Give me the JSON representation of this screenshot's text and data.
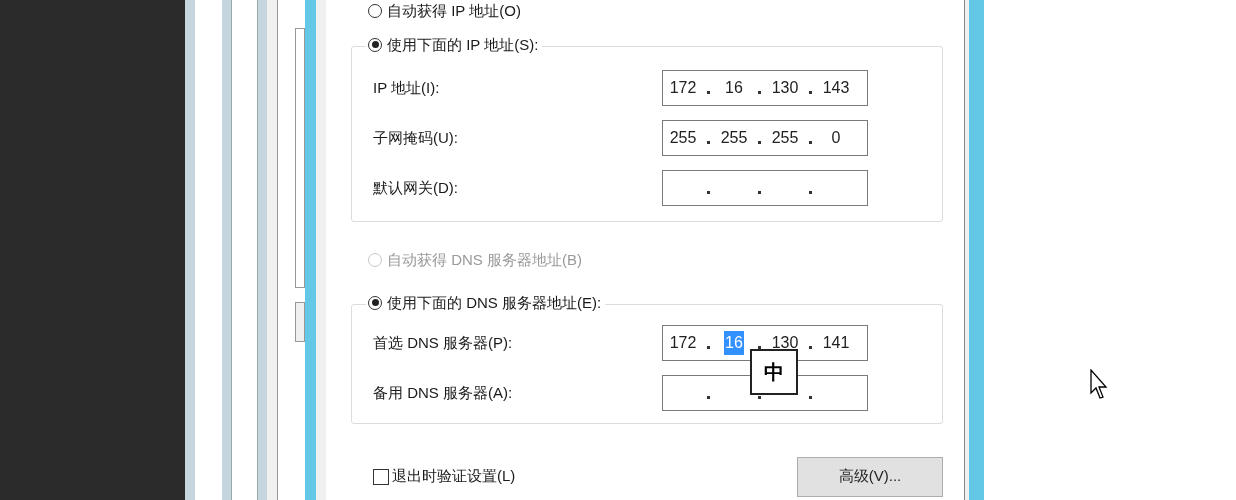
{
  "ip_mode": [
    {
      "label": "自动获得 IP 地址(O)",
      "selected": false,
      "disabled": false
    },
    {
      "label": "使用下面的 IP 地址(S):",
      "selected": true,
      "disabled": false
    }
  ],
  "ip_fields": [
    {
      "label": "IP 地址(I):",
      "octets": [
        {
          "text": "172",
          "selected": false
        },
        {
          "text": "16",
          "selected": false
        },
        {
          "text": "130",
          "selected": false
        },
        {
          "text": "143",
          "selected": false
        }
      ]
    },
    {
      "label": "子网掩码(U):",
      "octets": [
        {
          "text": "255",
          "selected": false
        },
        {
          "text": "255",
          "selected": false
        },
        {
          "text": "255",
          "selected": false
        },
        {
          "text": "0",
          "selected": false
        }
      ]
    },
    {
      "label": "默认网关(D):"
    }
  ],
  "dns_mode": [
    {
      "label": "自动获得 DNS 服务器地址(B)",
      "selected": false,
      "disabled": true
    },
    {
      "label": "使用下面的 DNS 服务器地址(E):",
      "selected": true,
      "disabled": false
    }
  ],
  "dns_fields": [
    {
      "label": "首选 DNS 服务器(P):",
      "octets": [
        {
          "text": "172",
          "selected": false
        },
        {
          "text": "16",
          "selected": true
        },
        {
          "text": "130",
          "selected": false
        },
        {
          "text": "141",
          "selected": false
        }
      ]
    },
    {
      "label": "备用 DNS 服务器(A):"
    }
  ],
  "ime_indicator": "中",
  "validate_on_exit": {
    "label": "退出时验证设置(L)",
    "checked": false
  },
  "advanced_button": "高级(V)..."
}
